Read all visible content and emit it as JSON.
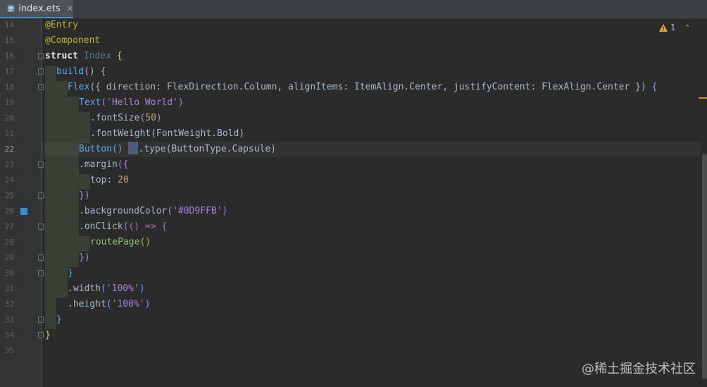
{
  "tab": {
    "label": "index.ets",
    "close_glyph": "✕",
    "icon": "ets-file-icon"
  },
  "warnings": {
    "count": "1",
    "icon": "warning-triangle-icon",
    "chevron": "⌃"
  },
  "colors": {
    "accent": "#4a88c7",
    "warning": "#f0a732",
    "background": "#2b2b2b",
    "gutter_mark": "#3592c4"
  },
  "line_numbers": [
    "14",
    "15",
    "16",
    "17",
    "18",
    "19",
    "20",
    "21",
    "22",
    "23",
    "24",
    "25",
    "26",
    "27",
    "28",
    "29",
    "30",
    "31",
    "32",
    "33",
    "34",
    "35"
  ],
  "code": {
    "l14_ann": "@Entry",
    "l15_ann": "@Component",
    "l16_kw": "struct",
    "l16_cls": "Index",
    "l16_brace": "{",
    "l17_fn": "build",
    "l17_rest": "() {",
    "l18_fn": "Flex",
    "l18_p1": "({ direction: FlexDirection.Column, alignItems: ItemAlign.Center, justifyContent: FlexAlign.Center })",
    "l18_brace": " {",
    "l19_fn": "Text",
    "l19_open": "(",
    "l19_str": "'Hello World'",
    "l19_close": ")",
    "l20_meth": ".fontSize",
    "l20_open": "(",
    "l20_num": "50",
    "l20_close": ")",
    "l21_meth": ".fontWeight",
    "l21_arg": "(FontWeight.Bold)",
    "l22_fn": "Button",
    "l22_paren": "()",
    "l22_meth": ".type",
    "l22_arg": "(ButtonType.Capsule)",
    "l23_meth": ".margin",
    "l23_open": "({",
    "l24_prop": "top",
    "l24_colon": ": ",
    "l24_num": "20",
    "l25_close": "})",
    "l26_meth": ".backgroundColor",
    "l26_open": "(",
    "l26_str": "'#0D9FFB'",
    "l26_close": ")",
    "l27_meth": ".onClick",
    "l27_open": "(",
    "l27_arrow": "() => {",
    "l28_fn": "routePage",
    "l28_paren": "()",
    "l29_close": "})",
    "l30_close": "}",
    "l31_meth": ".width",
    "l31_open": "(",
    "l31_str": "'100%'",
    "l31_close": ")",
    "l32_meth": ".height",
    "l32_open": "(",
    "l32_str": "'100%'",
    "l32_close": ")",
    "l33_close": "}",
    "l34_close": "}"
  },
  "watermark": "@稀土掘金技术社区"
}
